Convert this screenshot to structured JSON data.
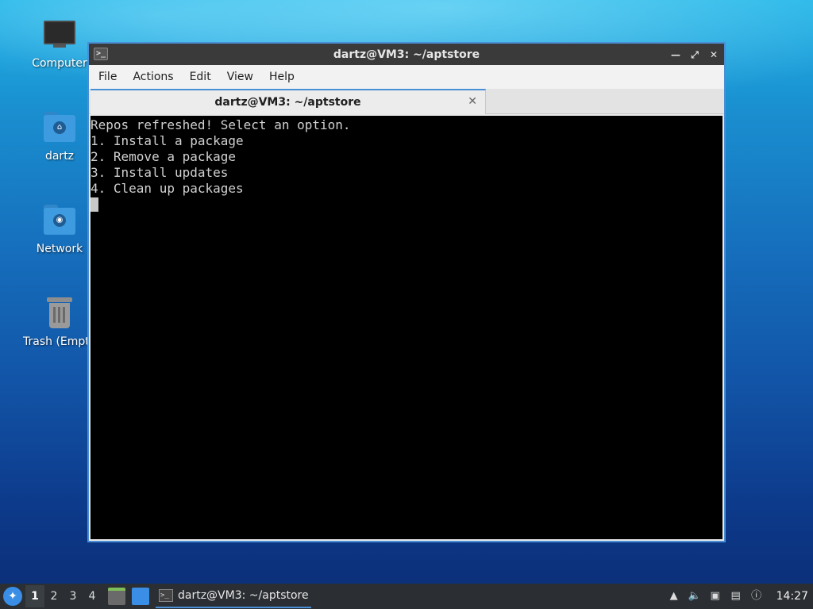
{
  "desktop": {
    "icons": [
      {
        "label": "Computer",
        "icon": "computer-icon"
      },
      {
        "label": "dartz",
        "icon": "home-folder-icon"
      },
      {
        "label": "Network",
        "icon": "network-folder-icon"
      },
      {
        "label": "Trash (Empty)",
        "icon": "trash-icon"
      }
    ]
  },
  "window": {
    "title": "dartz@VM3: ~/aptstore",
    "controls": [
      "minimize",
      "maximize",
      "close"
    ],
    "menu": [
      "File",
      "Actions",
      "Edit",
      "View",
      "Help"
    ],
    "tab": {
      "label": "dartz@VM3: ~/aptstore"
    },
    "terminal": {
      "lines": [
        "Repos refreshed! Select an option.",
        "1. Install a package",
        "2. Remove a package",
        "3. Install updates",
        "4. Clean up packages"
      ]
    }
  },
  "taskbar": {
    "workspaces": [
      "1",
      "2",
      "3",
      "4"
    ],
    "active_workspace": "1",
    "task_label": "dartz@VM3: ~/aptstore",
    "clock": "14:27"
  },
  "colors": {
    "accent": "#4a8fd6",
    "titlebar": "#3a3a3a",
    "taskbar": "#2b2f33",
    "terminal_bg": "#000000",
    "terminal_fg": "#d0d0d0"
  }
}
